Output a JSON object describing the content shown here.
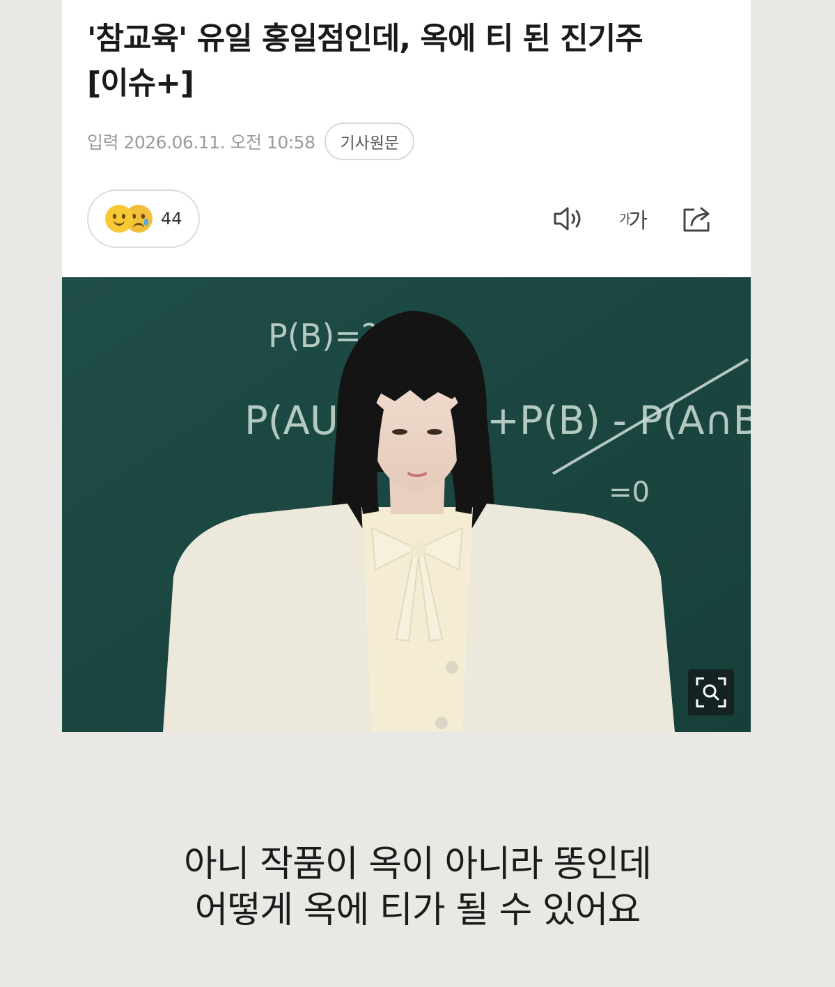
{
  "article": {
    "headline_line1": "'참교육' 유일 홍일점인데, 옥에 티 된 진기주",
    "headline_line2": "[이슈+]",
    "date": "입력 2026.06.11. 오전 10:58",
    "source_button": "기사원문",
    "reaction_count": "44",
    "font_tool_small": "가",
    "font_tool_large": "가"
  },
  "chalkboard": {
    "eq1": "P(B)=?",
    "eq2": "P(AU",
    "eq3": "+P(B) - P(A∩B)",
    "eq4": "=0"
  },
  "caption": {
    "line1": "아니 작품이 옥이 아니라 똥인데",
    "line2": "어떻게 옥에 티가 될 수 있어요"
  },
  "colors": {
    "chalkboard": "#1d4a44",
    "jacket": "#ece8dc",
    "blouse": "#f4edd3",
    "background": "#e9e8e4"
  },
  "icons": [
    "smile-emoji-icon",
    "crying-emoji-icon",
    "speaker-icon",
    "font-size-icon",
    "share-icon",
    "zoom-icon"
  ]
}
